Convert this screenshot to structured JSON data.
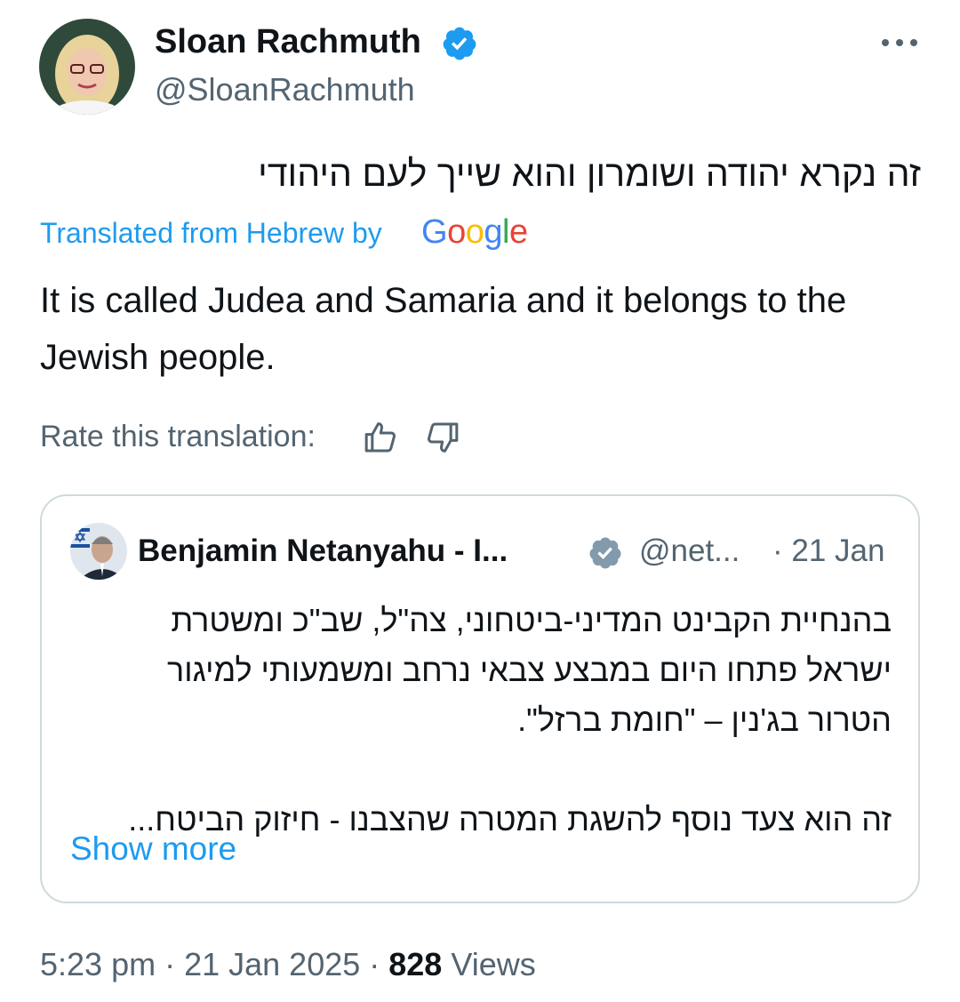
{
  "author": {
    "name": "Sloan Rachmuth",
    "handle": "@SloanRachmuth",
    "verified": true
  },
  "menu_icon": "more-horizontal-icon",
  "post": {
    "original_text": "זה נקרא יהודה ושומרון והוא שייך לעם היהודי",
    "translated_from": "Translated from Hebrew by",
    "translator_logo": "Google",
    "translation": "It is called Judea and Samaria and it belongs to the Jewish people.",
    "rate_label": "Rate this translation:",
    "rate_icons": [
      "thumbs-up-icon",
      "thumbs-down-icon"
    ]
  },
  "quote": {
    "name": "Benjamin Netanyahu - I...",
    "handle": "@net...",
    "date": "· 21 Jan",
    "verified": true,
    "lines": [
      "בהנחיית הקבינט המדיני-ביטחוני, צה\"ל, שב\"כ ומשטרת",
      "ישראל פתחו היום במבצע צבאי נרחב ומשמעותי למיגור",
      "הטרור בג'נין – \"חומת ברזל\".",
      "זה הוא צעד נוסף להשגת המטרה שהצבנו - חיזוק הביטח..."
    ],
    "show_more": "Show more"
  },
  "footer": {
    "time": "5:23 pm",
    "sep1": " · ",
    "date": "21 Jan 2025",
    "sep2": " · ",
    "views_count": "828",
    "views_label": " Views"
  },
  "colors": {
    "accent": "#1d9bf0",
    "text_primary": "#0f1419",
    "text_secondary": "#536471",
    "border": "#cfd9de",
    "quote_verified": "#829aab"
  }
}
